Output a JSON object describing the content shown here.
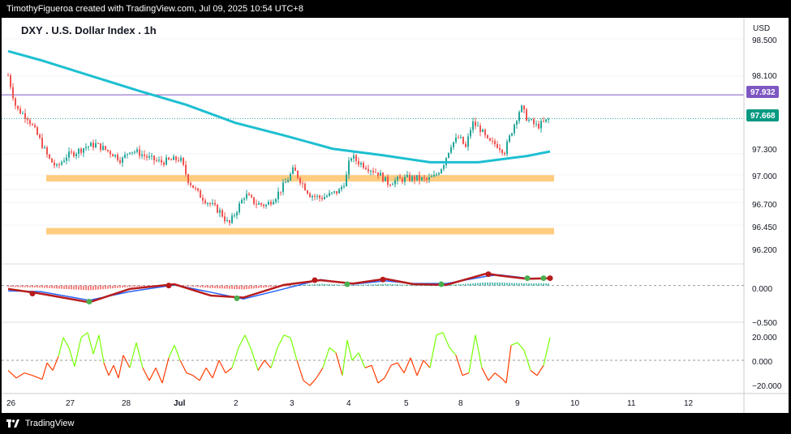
{
  "header": {
    "attribution": "TimothyFigueroa created with TradingView.com, Jul 09, 2025 10:54 UTC+8"
  },
  "footer": {
    "brand": "TradingView"
  },
  "chart": {
    "title": "DXY . U.S. Dollar Index . 1h",
    "currency": "USD",
    "price_axis_labels": [
      "98.500",
      "98.100",
      "97.300",
      "97.000",
      "96.700",
      "96.450",
      "96.200"
    ],
    "hline_label": "97.932",
    "last_price_label": "97.668",
    "date_labels": [
      "26",
      "27",
      "28",
      "Jul",
      "2",
      "3",
      "4",
      "5",
      "8",
      "9",
      "10",
      "11",
      "12"
    ],
    "macd_axis_labels": [
      "0.000",
      "−0.500"
    ],
    "osc_axis_labels": [
      "20.000",
      "0.000",
      "−20.000"
    ],
    "colors": {
      "up": "#26a69a",
      "down": "#ef5350",
      "ma": "#1ebfd1",
      "zone": "#ffcc80",
      "hline": "#7e57c2",
      "macd": "#4caf50",
      "signal": "#b71c1c",
      "macd2": "#2962ff"
    }
  },
  "chart_data": [
    {
      "type": "candlestick",
      "title": "DXY . U.S. Dollar Index . 1h",
      "ylim": [
        96.08,
        98.72
      ],
      "x": [
        "26",
        "27",
        "28",
        "Jul",
        "2",
        "3",
        "4",
        "5",
        "8",
        "9",
        "10",
        "11",
        "12"
      ],
      "horizontal_line": 97.932,
      "last_price": 97.668,
      "support_zones": [
        97.0,
        96.41
      ],
      "close_path": [
        [
          0,
          98.15
        ],
        [
          10,
          97.78
        ],
        [
          24,
          97.68
        ],
        [
          38,
          97.45
        ],
        [
          50,
          97.22
        ],
        [
          60,
          97.12
        ],
        [
          72,
          97.25
        ],
        [
          85,
          97.3
        ],
        [
          95,
          97.35
        ],
        [
          108,
          97.38
        ],
        [
          118,
          97.33
        ],
        [
          128,
          97.28
        ],
        [
          140,
          97.2
        ],
        [
          150,
          97.32
        ],
        [
          162,
          97.28
        ],
        [
          175,
          97.22
        ],
        [
          188,
          97.18
        ],
        [
          200,
          97.2
        ],
        [
          212,
          97.22
        ],
        [
          222,
          96.98
        ],
        [
          235,
          96.82
        ],
        [
          248,
          96.72
        ],
        [
          262,
          96.62
        ],
        [
          272,
          96.48
        ],
        [
          282,
          96.65
        ],
        [
          292,
          96.82
        ],
        [
          305,
          96.72
        ],
        [
          318,
          96.7
        ],
        [
          330,
          96.8
        ],
        [
          342,
          96.95
        ],
        [
          352,
          97.1
        ],
        [
          362,
          96.95
        ],
        [
          372,
          96.82
        ],
        [
          385,
          96.78
        ],
        [
          398,
          96.82
        ],
        [
          408,
          96.86
        ],
        [
          416,
          96.98
        ],
        [
          422,
          97.25
        ],
        [
          432,
          97.18
        ],
        [
          444,
          97.12
        ],
        [
          456,
          97.06
        ],
        [
          468,
          96.95
        ],
        [
          480,
          96.98
        ],
        [
          492,
          97.0
        ],
        [
          504,
          97.0
        ],
        [
          516,
          96.98
        ],
        [
          526,
          97.02
        ],
        [
          536,
          97.15
        ],
        [
          546,
          97.38
        ],
        [
          556,
          97.46
        ],
        [
          564,
          97.34
        ],
        [
          572,
          97.62
        ],
        [
          582,
          97.55
        ],
        [
          592,
          97.4
        ],
        [
          602,
          97.38
        ],
        [
          612,
          97.3
        ],
        [
          622,
          97.56
        ],
        [
          632,
          97.8
        ],
        [
          640,
          97.66
        ],
        [
          652,
          97.58
        ],
        [
          660,
          97.62
        ],
        [
          668,
          97.668
        ]
      ],
      "moving_average": [
        [
          0,
          98.42
        ],
        [
          40,
          98.32
        ],
        [
          100,
          98.15
        ],
        [
          160,
          97.98
        ],
        [
          220,
          97.82
        ],
        [
          280,
          97.62
        ],
        [
          340,
          97.48
        ],
        [
          400,
          97.33
        ],
        [
          460,
          97.26
        ],
        [
          520,
          97.18
        ],
        [
          580,
          97.18
        ],
        [
          640,
          97.25
        ],
        [
          668,
          97.3
        ]
      ]
    },
    {
      "type": "line",
      "ylim": [
        -0.5,
        0.25
      ],
      "series": [
        {
          "values": [
            [
              0,
              -0.05
            ],
            [
              40,
              -0.12
            ],
            [
              100,
              -0.25
            ],
            [
              150,
              -0.05
            ],
            [
              205,
              0.02
            ],
            [
              250,
              -0.15
            ],
            [
              290,
              -0.18
            ],
            [
              340,
              0.01
            ],
            [
              385,
              0.08
            ],
            [
              425,
              0.03
            ],
            [
              465,
              0.1
            ],
            [
              500,
              0.02
            ],
            [
              540,
              0.01
            ],
            [
              590,
              0.18
            ],
            [
              605,
              0.15
            ],
            [
              640,
              0.1
            ],
            [
              668,
              0.11
            ]
          ]
        },
        {
          "values": [
            [
              0,
              -0.08
            ],
            [
              40,
              -0.09
            ],
            [
              100,
              -0.22
            ],
            [
              150,
              -0.09
            ],
            [
              205,
              0.01
            ],
            [
              250,
              -0.1
            ],
            [
              290,
              -0.2
            ],
            [
              340,
              -0.05
            ],
            [
              385,
              0.09
            ],
            [
              425,
              0.02
            ],
            [
              465,
              0.07
            ],
            [
              500,
              0.03
            ],
            [
              540,
              0.03
            ],
            [
              590,
              0.14
            ],
            [
              605,
              0.16
            ],
            [
              640,
              0.11
            ],
            [
              668,
              0.11
            ]
          ]
        }
      ]
    },
    {
      "type": "line",
      "ylim": [
        -25,
        25
      ],
      "series": [
        {
          "values": [
            [
              0,
              -8
            ],
            [
              10,
              -14
            ],
            [
              20,
              -10
            ],
            [
              30,
              -12
            ],
            [
              42,
              -15
            ],
            [
              48,
              -2
            ],
            [
              55,
              -8
            ],
            [
              62,
              3
            ],
            [
              68,
              18
            ],
            [
              75,
              10
            ],
            [
              82,
              -5
            ],
            [
              90,
              18
            ],
            [
              98,
              22
            ],
            [
              105,
              5
            ],
            [
              112,
              20
            ],
            [
              118,
              -2
            ],
            [
              124,
              -12
            ],
            [
              130,
              -4
            ],
            [
              136,
              -14
            ],
            [
              142,
              4
            ],
            [
              150,
              -6
            ],
            [
              158,
              14
            ],
            [
              166,
              -6
            ],
            [
              174,
              -16
            ],
            [
              182,
              -6
            ],
            [
              190,
              -18
            ],
            [
              198,
              2
            ],
            [
              205,
              12
            ],
            [
              212,
              0
            ],
            [
              220,
              -10
            ],
            [
              228,
              -12
            ],
            [
              236,
              -16
            ],
            [
              244,
              -6
            ],
            [
              252,
              -14
            ],
            [
              260,
              0
            ],
            [
              268,
              -10
            ],
            [
              276,
              -6
            ],
            [
              284,
              10
            ],
            [
              292,
              20
            ],
            [
              300,
              8
            ],
            [
              308,
              -8
            ],
            [
              316,
              0
            ],
            [
              324,
              -6
            ],
            [
              332,
              10
            ],
            [
              340,
              20
            ],
            [
              348,
              18
            ],
            [
              356,
              0
            ],
            [
              364,
              -16
            ],
            [
              372,
              -20
            ],
            [
              380,
              -14
            ],
            [
              388,
              -6
            ],
            [
              396,
              10
            ],
            [
              404,
              6
            ],
            [
              412,
              -12
            ],
            [
              418,
              16
            ],
            [
              424,
              0
            ],
            [
              432,
              6
            ],
            [
              440,
              -6
            ],
            [
              448,
              -4
            ],
            [
              456,
              -18
            ],
            [
              464,
              -14
            ],
            [
              472,
              -4
            ],
            [
              480,
              -2
            ],
            [
              488,
              -10
            ],
            [
              496,
              2
            ],
            [
              504,
              -12
            ],
            [
              512,
              0
            ],
            [
              520,
              -6
            ],
            [
              528,
              20
            ],
            [
              536,
              22
            ],
            [
              544,
              10
            ],
            [
              552,
              4
            ],
            [
              560,
              -12
            ],
            [
              568,
              -10
            ],
            [
              576,
              20
            ],
            [
              584,
              -6
            ],
            [
              592,
              -16
            ],
            [
              600,
              -10
            ],
            [
              608,
              -14
            ],
            [
              614,
              -18
            ],
            [
              620,
              12
            ],
            [
              628,
              14
            ],
            [
              636,
              8
            ],
            [
              644,
              -8
            ],
            [
              652,
              -12
            ],
            [
              660,
              -4
            ],
            [
              668,
              18
            ]
          ]
        }
      ]
    }
  ]
}
